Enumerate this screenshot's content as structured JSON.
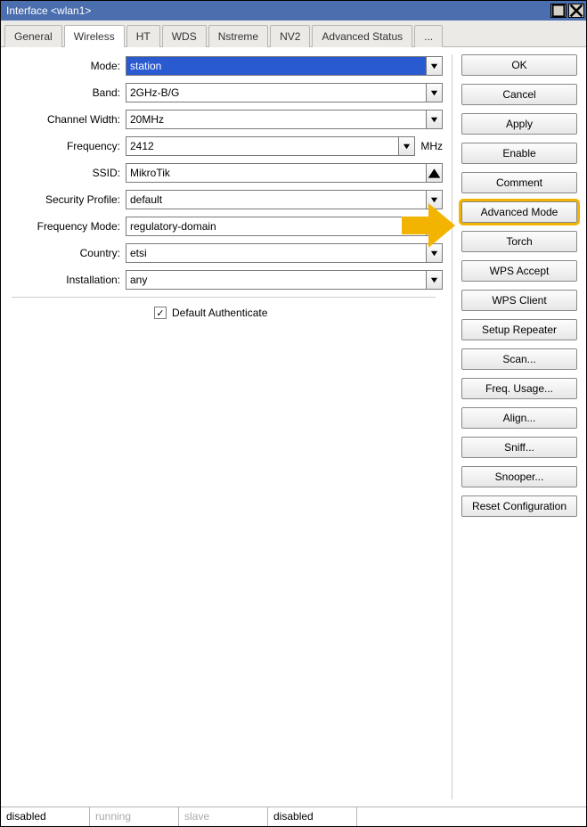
{
  "window": {
    "title": "Interface <wlan1>"
  },
  "tabs": {
    "items": [
      "General",
      "Wireless",
      "HT",
      "WDS",
      "Nstreme",
      "NV2",
      "Advanced Status",
      "..."
    ],
    "active_index": 1
  },
  "form": {
    "mode": {
      "label": "Mode:",
      "value": "station"
    },
    "band": {
      "label": "Band:",
      "value": "2GHz-B/G"
    },
    "channel_width": {
      "label": "Channel Width:",
      "value": "20MHz"
    },
    "frequency": {
      "label": "Frequency:",
      "value": "2412",
      "unit": "MHz"
    },
    "ssid": {
      "label": "SSID:",
      "value": "MikroTik"
    },
    "security_profile": {
      "label": "Security Profile:",
      "value": "default"
    },
    "frequency_mode": {
      "label": "Frequency Mode:",
      "value": "regulatory-domain"
    },
    "country": {
      "label": "Country:",
      "value": "etsi"
    },
    "installation": {
      "label": "Installation:",
      "value": "any"
    },
    "default_authenticate": {
      "label": "Default Authenticate",
      "checked": true
    }
  },
  "buttons": {
    "ok": "OK",
    "cancel": "Cancel",
    "apply": "Apply",
    "enable": "Enable",
    "comment": "Comment",
    "advanced_mode": "Advanced Mode",
    "torch": "Torch",
    "wps_accept": "WPS Accept",
    "wps_client": "WPS Client",
    "setup_repeater": "Setup Repeater",
    "scan": "Scan...",
    "freq_usage": "Freq. Usage...",
    "align": "Align...",
    "sniff": "Sniff...",
    "snooper": "Snooper...",
    "reset_configuration": "Reset Configuration"
  },
  "statusbar": {
    "items": [
      "disabled",
      "running",
      "slave",
      "disabled",
      ""
    ]
  }
}
